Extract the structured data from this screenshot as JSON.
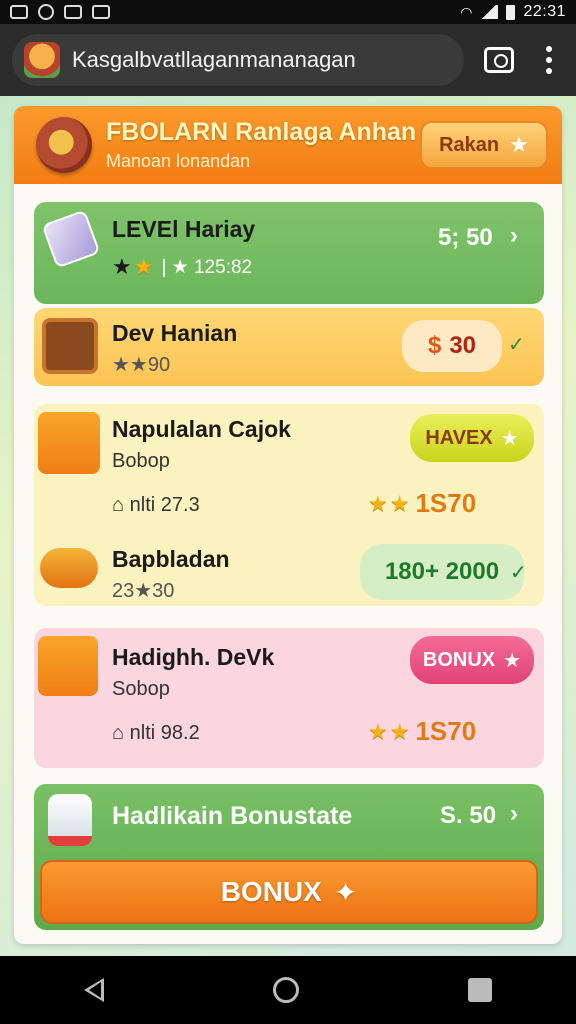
{
  "status": {
    "time": "22:31"
  },
  "browser": {
    "url": "Kasgalbvatllaganmananagan"
  },
  "header": {
    "title": "FBOLARN Ranlaga Anhan",
    "subtitle": "Manoan lonandan",
    "button_label": "Rakan"
  },
  "level": {
    "title": "LEVEl Hariay",
    "stars_meta": "| ★ 125:82",
    "price": "5; 50"
  },
  "dev": {
    "title": "Dev Hanian",
    "meta": "★★90",
    "badge_value": "30"
  },
  "napulalan": {
    "title": "Napulalan Cajok",
    "sub": "Bobop",
    "meta": "nlti 27.3",
    "badge_label": "HAVEX",
    "value": "1S70"
  },
  "bapbladan": {
    "title": "Bapbladan",
    "meta": "23★30",
    "badge_value": "180+ 2000"
  },
  "hadighh": {
    "title": "Hadighh. DeVk",
    "sub": "Sobop",
    "meta": "nlti 98.2",
    "badge_label": "BONUX",
    "value": "1S70"
  },
  "bonus_card": {
    "title": "Hadlikain Bonustate",
    "price": "S. 50",
    "button_label": "BONUX"
  },
  "colors": {
    "accent": "#f27d12",
    "green": "#6cb65a",
    "pink": "#e04277"
  }
}
